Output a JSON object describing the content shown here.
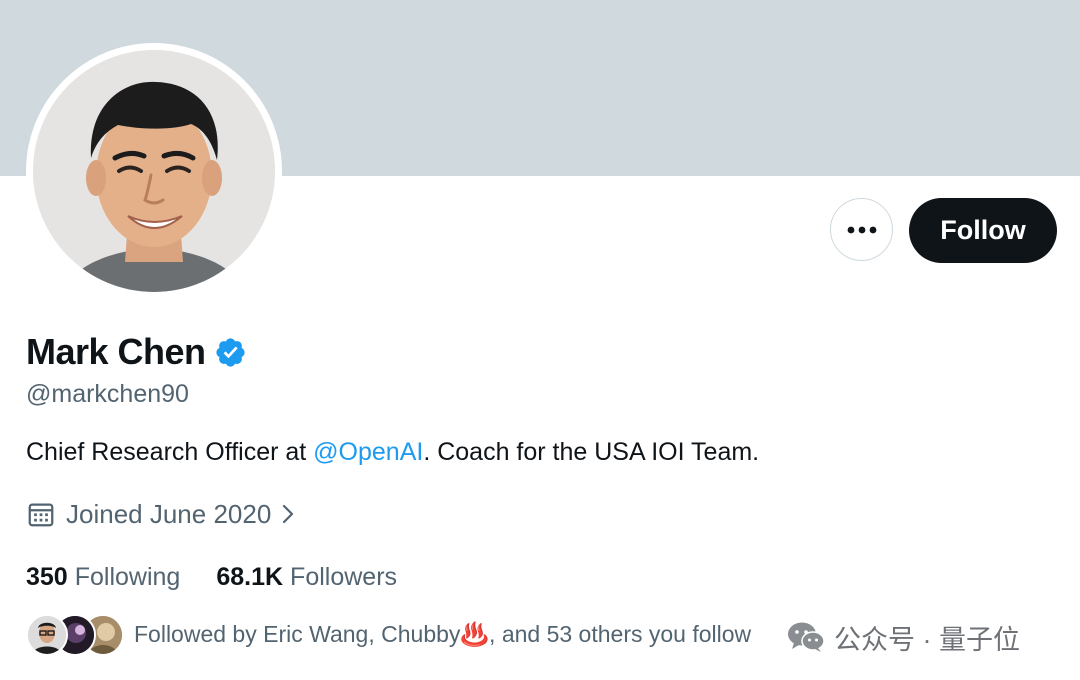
{
  "profile": {
    "display_name": "Mark Chen",
    "verified": true,
    "handle": "@markchen90",
    "bio_prefix": "Chief Research Officer at ",
    "bio_mention": "@OpenAI",
    "bio_suffix": ". Coach for the USA IOI Team.",
    "joined": "Joined June 2020",
    "following_count": "350",
    "following_label": "Following",
    "followers_count": "68.1K",
    "followers_label": "Followers",
    "followed_by": "Followed by Eric Wang, Chubby♨️, and 53 others you follow"
  },
  "actions": {
    "follow_label": "Follow",
    "more_icon": "more-horizontal-icon"
  },
  "watermark": {
    "text": "公众号 · 量子位",
    "icon": "wechat-icon"
  },
  "colors": {
    "banner": "#cfd9de",
    "primary_text": "#0f1419",
    "secondary_text": "#536471",
    "accent": "#1d9bf0",
    "follow_button_bg": "#0f1419"
  }
}
